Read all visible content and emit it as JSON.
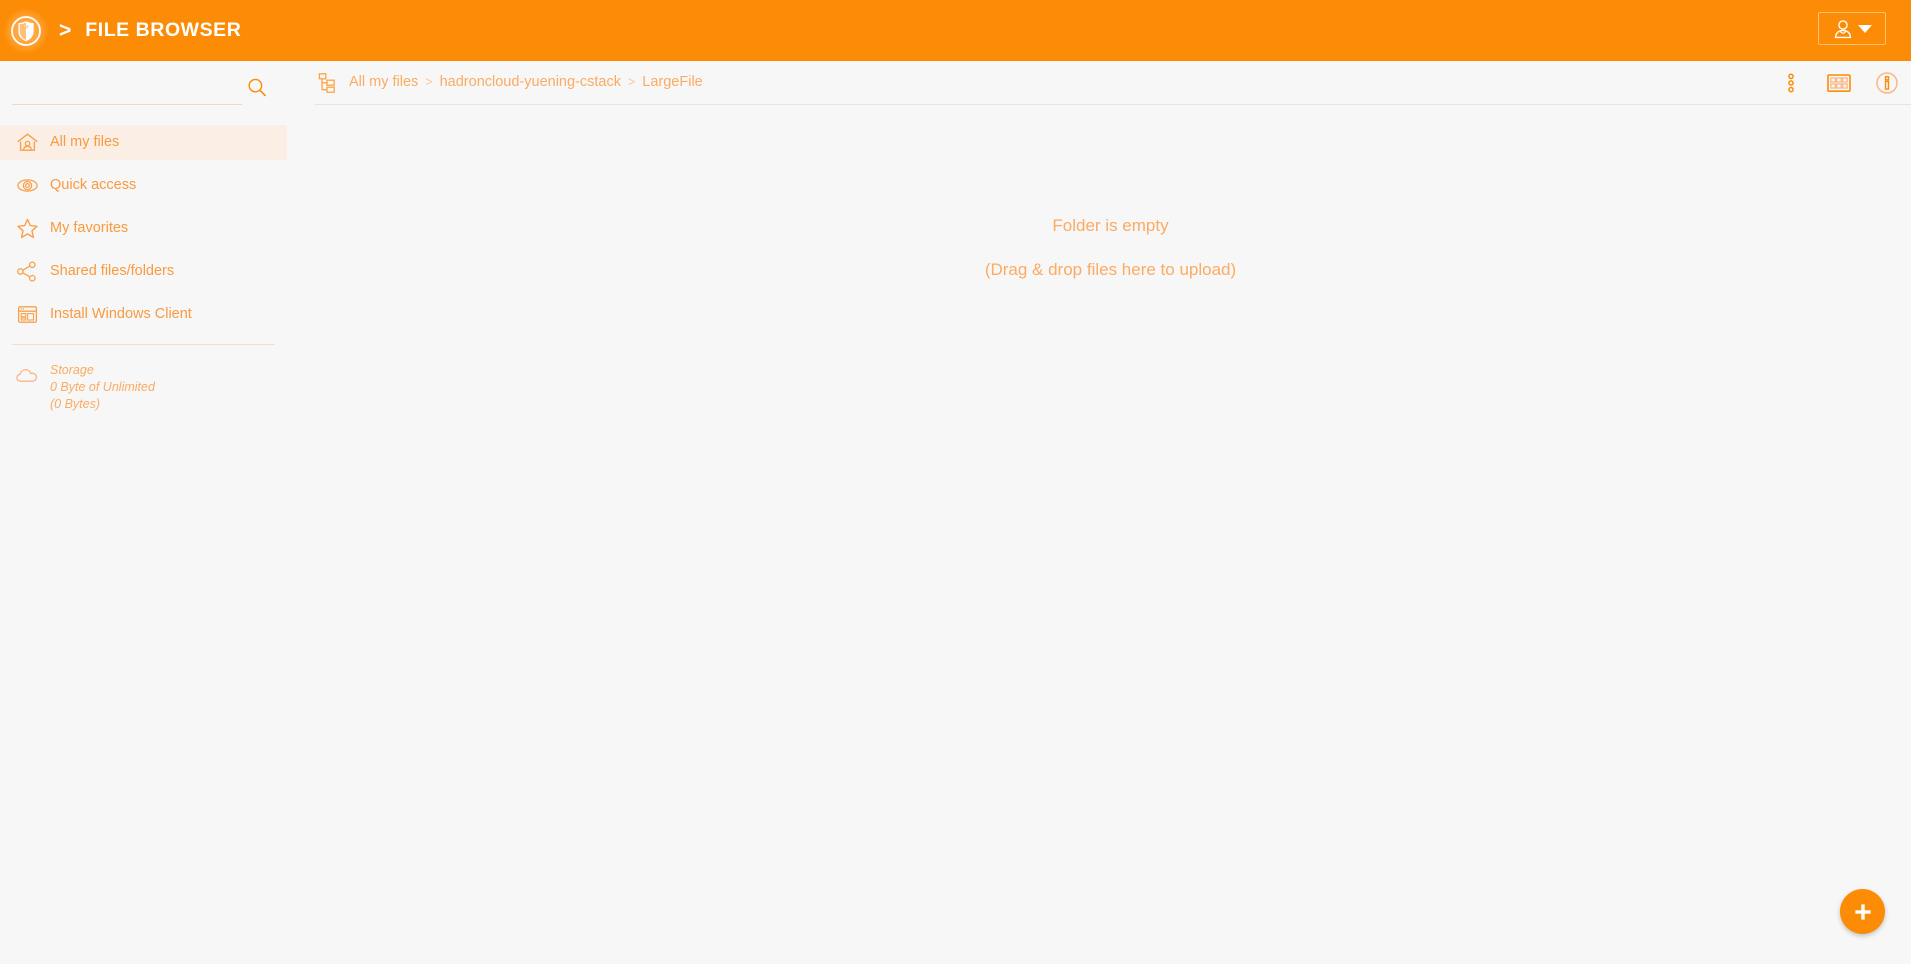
{
  "header": {
    "logo_icon": "shield-eagle-logo",
    "chevron": ">",
    "title": "FILE BROWSER",
    "account": {
      "icon": "user-avatar-icon",
      "caret_icon": "chevron-down-icon"
    }
  },
  "sidebar": {
    "search": {
      "value": "",
      "placeholder": "",
      "icon": "search-icon"
    },
    "items": [
      {
        "label": "All my files",
        "icon": "home-icon",
        "active": true
      },
      {
        "label": "Quick access",
        "icon": "eye-icon",
        "active": false
      },
      {
        "label": "My favorites",
        "icon": "star-icon",
        "active": false
      },
      {
        "label": "Shared files/folders",
        "icon": "share-nodes-icon",
        "active": false
      },
      {
        "label": "Install Windows Client",
        "icon": "app-window-icon",
        "active": false
      }
    ],
    "storage": {
      "icon": "cloud-icon",
      "title": "Storage",
      "usage": "0 Byte of Unlimited",
      "detail": "(0 Bytes)"
    }
  },
  "breadcrumb": {
    "icon": "folder-tree-icon",
    "separator": ">",
    "items": [
      {
        "label": "All my files"
      },
      {
        "label": "hadroncloud-yuening-cstack"
      },
      {
        "label": "LargeFile"
      }
    ]
  },
  "toolbar": {
    "more_icon": "more-vertical-icon",
    "grid_icon": "grid-view-icon",
    "info_icon": "info-circle-icon"
  },
  "content": {
    "empty_title": "Folder is empty",
    "empty_subtitle": "(Drag & drop files here to upload)"
  },
  "fab": {
    "icon": "plus-icon",
    "label": "+"
  },
  "colors": {
    "brand_orange": "#fc8c05",
    "text_orange": "#fbab62",
    "nav_label": "#f99a3f",
    "active_row": "#fbeee4",
    "page_bg": "#f7f7f7",
    "rule": "#e4e4e4"
  }
}
